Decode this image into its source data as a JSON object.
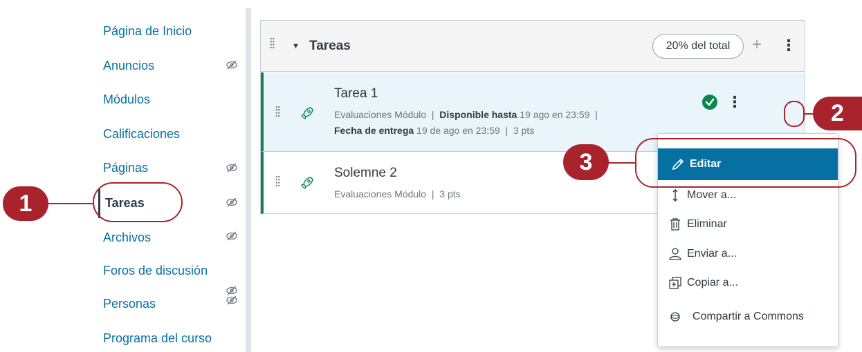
{
  "nav": {
    "items": [
      {
        "label": "Página de Inicio",
        "hidden": false
      },
      {
        "label": "Anuncios",
        "hidden": true
      },
      {
        "label": "Módulos",
        "hidden": false
      },
      {
        "label": "Calificaciones",
        "hidden": false
      },
      {
        "label": "Páginas",
        "hidden": true
      },
      {
        "label": "Tareas",
        "hidden": true,
        "active": true
      },
      {
        "label": "Archivos",
        "hidden": true
      },
      {
        "label": "Foros de discusión",
        "hidden": true
      },
      {
        "label": "Personas",
        "hidden": true
      },
      {
        "label": "Programa del curso",
        "hidden": true
      }
    ]
  },
  "group": {
    "title": "Tareas",
    "weight": "20% del total"
  },
  "assignments": [
    {
      "title": "Tarea 1",
      "module": "Evaluaciones Módulo",
      "available_label": "Disponible hasta",
      "available_value": "19 ago en 23:59",
      "due_label": "Fecha de entrega",
      "due_value": "19 de ago en 23:59",
      "points": "3 pts",
      "published": true
    },
    {
      "title": "Solemne 2",
      "module": "Evaluaciones Módulo",
      "points": "3 pts"
    }
  ],
  "menu": {
    "items": [
      {
        "label": "Editar",
        "icon": "pencil-icon"
      },
      {
        "label": "Mover a...",
        "icon": "move-icon"
      },
      {
        "label": "Eliminar",
        "icon": "trash-icon"
      },
      {
        "label": "Enviar a...",
        "icon": "user-icon"
      },
      {
        "label": "Copiar a...",
        "icon": "copy-icon"
      },
      {
        "label": "Compartir a Commons",
        "icon": "commons-icon"
      }
    ]
  },
  "callouts": [
    "1",
    "2",
    "3"
  ],
  "colors": {
    "link": "#0770a3",
    "accent_green": "#0b874b",
    "callout": "#a8232b",
    "menu_highlight": "#0770a3"
  }
}
